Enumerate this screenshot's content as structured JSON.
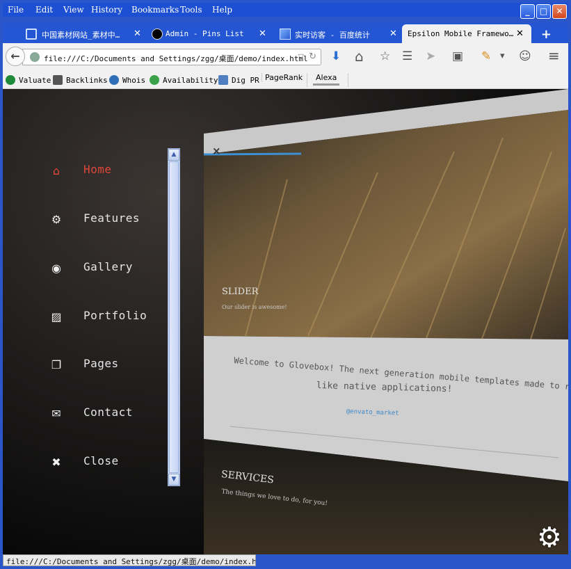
{
  "menu": [
    "File",
    "Edit",
    "View",
    "History",
    "Bookmarks",
    "Tools",
    "Help"
  ],
  "window_buttons": {
    "minimize": "_",
    "maximize": "□",
    "close": "✕"
  },
  "tabs": [
    {
      "label": "中国素材网站_素材中…",
      "close": "✕"
    },
    {
      "label": "Admin - Pins List",
      "close": "✕"
    },
    {
      "label": "实时访客 - 百度统计",
      "close": "✕"
    },
    {
      "label": "Epsilon Mobile Framewo…",
      "close": "✕"
    }
  ],
  "new_tab": "+",
  "nav": {
    "back": "←",
    "url": "file:///C:/Documents and Settings/zgg/桌面/demo/index.html",
    "dropdown": "▽",
    "reload": "↻",
    "download": "⬇",
    "home": "⌂",
    "star": "☆",
    "reader": "☰",
    "send": "➤",
    "pocket": "▣",
    "extension": "✎",
    "menu_arrow": "▾",
    "smiley": "☺",
    "hamburger": "≡"
  },
  "bookmarks": [
    {
      "label": "Valuate",
      "icon": "dollar-icon",
      "color": "#1f8a3a"
    },
    {
      "label": "Backlinks",
      "icon": "arrows-icon",
      "color": "#333333"
    },
    {
      "label": "Whois",
      "icon": "globe-icon",
      "color": "#2f6fb7"
    },
    {
      "label": "Availability",
      "icon": "search-icon",
      "color": "#3aa34a"
    },
    {
      "label": "Dig PR",
      "icon": "network-icon",
      "color": "#4f7fc0"
    },
    {
      "label": "PageRank",
      "icon": "",
      "color": ""
    },
    {
      "label": "Alexa",
      "icon": "",
      "color": ""
    }
  ],
  "sidebar": [
    {
      "label": "Home",
      "icon": "home-icon",
      "glyph": "⌂",
      "active": true
    },
    {
      "label": "Features",
      "icon": "gear-icon",
      "glyph": "⚙",
      "active": false
    },
    {
      "label": "Gallery",
      "icon": "camera-icon",
      "glyph": "◉",
      "active": false
    },
    {
      "label": "Portfolio",
      "icon": "image-icon",
      "glyph": "▨",
      "active": false
    },
    {
      "label": "Pages",
      "icon": "copy-icon",
      "glyph": "❐",
      "active": false
    },
    {
      "label": "Contact",
      "icon": "envelope-icon",
      "glyph": "✉",
      "active": false
    },
    {
      "label": "Close",
      "icon": "close-icon",
      "glyph": "✖",
      "active": false
    }
  ],
  "scrollbar": {
    "up": "▲",
    "down": "▼"
  },
  "card": {
    "close": "×",
    "slider_title": "SLIDER",
    "slider_sub": "Our slider is awesome!",
    "welcome_line1": "Welcome to Glovebox! The next generation mobile templates made to run",
    "welcome_line2": "like native applications!",
    "handle": "@envato_market",
    "services_title": "SERVICES",
    "services_sub": "The things we love to do, for you!"
  },
  "colors": {
    "accent": "#e0473a",
    "link": "#3c88c8",
    "progress": "#3d8fd4"
  },
  "status": "file:///C:/Documents and Settings/zgg/桌面/demo/index.html#",
  "gear_glyph": "⚙"
}
